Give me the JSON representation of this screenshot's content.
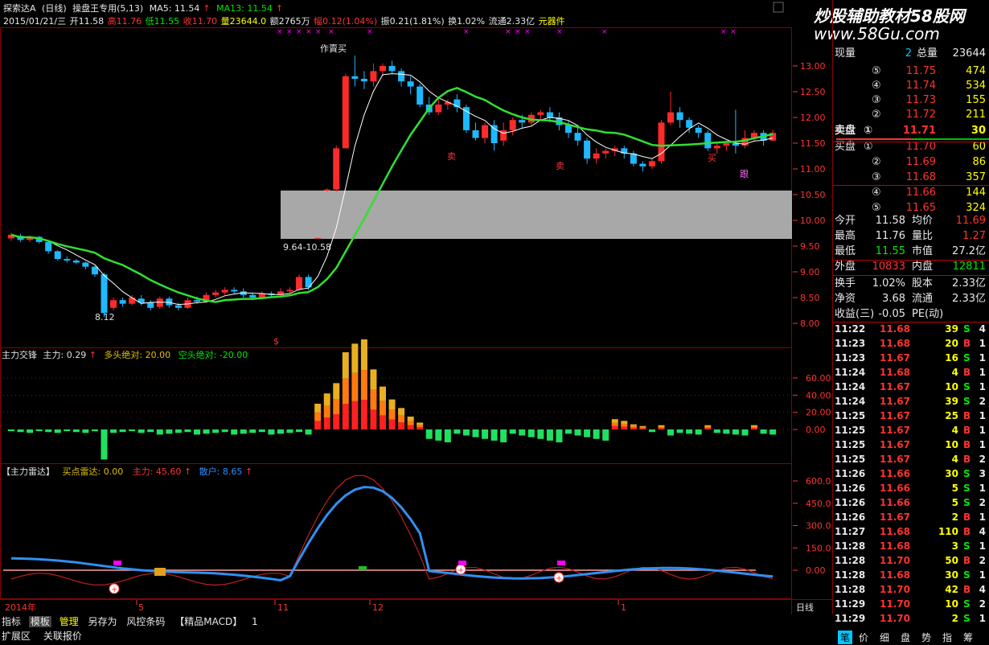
{
  "header": {
    "stock_name": "探索达A",
    "period": "(日线)",
    "indicator_name": "操盘王专用(5,13)",
    "ma5_label": "MA5: 11.54",
    "ma13_label": "MA13: 11.54",
    "arrow": "↑",
    "date": "2015/01/21/三",
    "open": "开11.58",
    "high": "高11.76",
    "low": "低11.55",
    "close": "收11.70",
    "volume": "量23644.0",
    "amount": "额2765万",
    "change": "幅0.12(1.04%)",
    "amplitude": "振0.21(1.81%)",
    "turnover": "换1.02%",
    "float_cap": "流通2.33亿",
    "component": "元器件"
  },
  "watermark": {
    "line1": "炒股辅助教材58股网",
    "line2": "www.58Gu.com"
  },
  "price_axis": [
    "13.00",
    "12.50",
    "12.00",
    "11.50",
    "11.00",
    "10.50",
    "10.00",
    "9.50",
    "9.00",
    "8.50",
    "8.00"
  ],
  "chart_annotations": {
    "range_label": "9.64-10.58",
    "low_label": "8.12",
    "buy_label_1": "买",
    "sell_label_1": "卖",
    "sell_label_2": "卖",
    "follow_label": "跟",
    "sell_top_label": "作賣买",
    "dollar_label": "$"
  },
  "panel2": {
    "title": "主力交锋",
    "zhuli": "主力: 0.29",
    "arrow": "↑",
    "duotou": "多头绝对: 20.00",
    "kongtou": "空头绝对: -20.00",
    "axis": [
      "60.00",
      "40.00",
      "20.00",
      "0.00"
    ]
  },
  "panel3": {
    "title": "【主力雷达】",
    "buy_radar": "买点雷达: 0.00",
    "zhuli": "主力: 45.60",
    "arrow": "↑",
    "sanhu": "散户: 8.65",
    "axis": [
      "600.0",
      "450.0",
      "300.0",
      "150.0",
      "0.00"
    ]
  },
  "time_axis": {
    "year_label": "2014年",
    "m5": "5",
    "m11": "11",
    "m12": "12",
    "m1": "1",
    "period": "日线"
  },
  "zoom": {
    "plus": "+",
    "minus": "-",
    "zero": "0"
  },
  "quote": {
    "xianliang_label": "现量",
    "xianliang": "2",
    "zongliang_label": "总量",
    "zongliang": "23644",
    "sell": [
      {
        "n": "⑤",
        "price": "11.75",
        "vol": "474"
      },
      {
        "n": "④",
        "price": "11.74",
        "vol": "534"
      },
      {
        "n": "③",
        "price": "11.73",
        "vol": "155"
      },
      {
        "n": "②",
        "price": "11.72",
        "vol": "211"
      },
      {
        "n": "①",
        "price": "11.71",
        "vol": "30"
      }
    ],
    "sell_label": "卖盘",
    "buy_label": "买盘",
    "buy": [
      {
        "n": "①",
        "price": "11.70",
        "vol": "60"
      },
      {
        "n": "②",
        "price": "11.69",
        "vol": "86"
      },
      {
        "n": "③",
        "price": "11.68",
        "vol": "357"
      },
      {
        "n": "④",
        "price": "11.66",
        "vol": "144"
      },
      {
        "n": "⑤",
        "price": "11.65",
        "vol": "324"
      }
    ],
    "stats": [
      {
        "l1": "今开",
        "v1": "11.58",
        "l2": "均价",
        "v2": "11.69"
      },
      {
        "l1": "最高",
        "v1": "11.76",
        "l2": "量比",
        "v2": "1.27"
      },
      {
        "l1": "最低",
        "v1": "11.55",
        "l2": "市值",
        "v2": "27.2亿"
      },
      {
        "l1": "外盘",
        "v1": "10833",
        "l2": "内盘",
        "v2": "12811"
      }
    ],
    "stats2": [
      {
        "l1": "换手",
        "v1": "1.02%",
        "l2": "股本",
        "v2": "2.33亿"
      },
      {
        "l1": "净资",
        "v1": "3.68",
        "l2": "流通",
        "v2": "2.33亿"
      },
      {
        "l1": "收益(三)",
        "v1": "-0.05",
        "l2": "PE(动)",
        "v2": ""
      }
    ]
  },
  "ticks": [
    {
      "t": "11:22",
      "p": "11.68",
      "v": "39",
      "d": "S",
      "n": "4"
    },
    {
      "t": "11:23",
      "p": "11.68",
      "v": "20",
      "d": "B",
      "n": "1"
    },
    {
      "t": "11:23",
      "p": "11.67",
      "v": "16",
      "d": "S",
      "n": "1"
    },
    {
      "t": "11:24",
      "p": "11.68",
      "v": "4",
      "d": "B",
      "n": "1"
    },
    {
      "t": "11:24",
      "p": "11.67",
      "v": "10",
      "d": "S",
      "n": "1"
    },
    {
      "t": "11:24",
      "p": "11.67",
      "v": "39",
      "d": "S",
      "n": "2"
    },
    {
      "t": "11:25",
      "p": "11.67",
      "v": "25",
      "d": "B",
      "n": "1"
    },
    {
      "t": "11:25",
      "p": "11.67",
      "v": "4",
      "d": "B",
      "n": "1"
    },
    {
      "t": "11:25",
      "p": "11.67",
      "v": "10",
      "d": "B",
      "n": "1"
    },
    {
      "t": "11:25",
      "p": "11.67",
      "v": "4",
      "d": "B",
      "n": "2"
    },
    {
      "t": "11:26",
      "p": "11.66",
      "v": "30",
      "d": "S",
      "n": "3"
    },
    {
      "t": "11:26",
      "p": "11.66",
      "v": "5",
      "d": "S",
      "n": "1"
    },
    {
      "t": "11:26",
      "p": "11.66",
      "v": "5",
      "d": "S",
      "n": "2"
    },
    {
      "t": "11:26",
      "p": "11.67",
      "v": "2",
      "d": "B",
      "n": "1"
    },
    {
      "t": "11:27",
      "p": "11.68",
      "v": "110",
      "d": "B",
      "n": "4"
    },
    {
      "t": "11:28",
      "p": "11.68",
      "v": "3",
      "d": "S",
      "n": "1"
    },
    {
      "t": "11:28",
      "p": "11.70",
      "v": "50",
      "d": "B",
      "n": "2"
    },
    {
      "t": "11:28",
      "p": "11.68",
      "v": "30",
      "d": "S",
      "n": "1"
    },
    {
      "t": "11:28",
      "p": "11.70",
      "v": "42",
      "d": "B",
      "n": "4"
    },
    {
      "t": "11:29",
      "p": "11.70",
      "v": "10",
      "d": "S",
      "n": "2"
    },
    {
      "t": "11:29",
      "p": "11.70",
      "v": "2",
      "d": "S",
      "n": "1"
    }
  ],
  "bottom_bar": {
    "items": [
      "指标",
      "模板",
      "管理",
      "另存为",
      "风控条码",
      "【精品MACD】",
      "1"
    ]
  },
  "bottom_bar2": {
    "items": [
      "扩展区",
      "关联报价"
    ]
  },
  "right_tabs": [
    "笔",
    "价",
    "细",
    "盘",
    "势",
    "指",
    "筹"
  ],
  "colors": {
    "up": "#ff3232",
    "down": "#00c8ff",
    "ma13": "#30e030",
    "grid": "#5a0000",
    "zone": "#a0a0a0"
  }
}
